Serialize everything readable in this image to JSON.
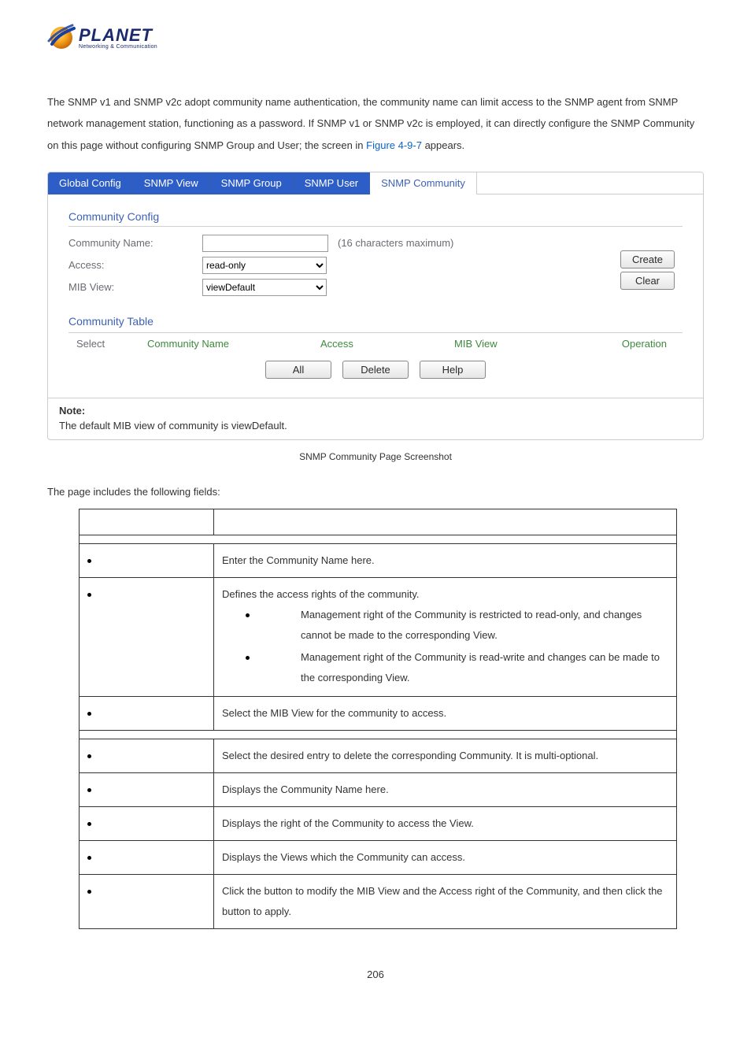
{
  "logo": {
    "word": "PLANET",
    "subtitle": "Networking & Communication"
  },
  "intro": {
    "text_before_link": "The SNMP v1 and SNMP v2c adopt community name authentication, the community name can limit access to the SNMP agent from SNMP network management station, functioning as a password. If SNMP v1 or SNMP v2c is employed, it can directly configure the SNMP Community on this page without configuring SNMP Group and User; the screen in ",
    "link_text": "Figure 4-9-7",
    "text_after_link": " appears."
  },
  "screenshot": {
    "tabs": [
      "Global Config",
      "SNMP View",
      "SNMP Group",
      "SNMP User",
      "SNMP Community"
    ],
    "active_tab_index": 4,
    "community_config": {
      "title": "Community Config",
      "rows": {
        "name_label": "Community Name:",
        "name_value": "",
        "name_hint": "(16 characters maximum)",
        "access_label": "Access:",
        "access_value": "read-only",
        "mib_label": "MIB View:",
        "mib_value": "viewDefault"
      },
      "buttons": {
        "create": "Create",
        "clear": "Clear"
      }
    },
    "community_table": {
      "title": "Community Table",
      "headers": {
        "select": "Select",
        "cname": "Community Name",
        "access": "Access",
        "mib": "MIB View",
        "op": "Operation"
      },
      "buttons": {
        "all": "All",
        "delete": "Delete",
        "help": "Help"
      }
    },
    "note": {
      "title": "Note:",
      "text": "The default MIB view of community is viewDefault."
    }
  },
  "caption": "SNMP Community Page Screenshot",
  "intro2": "The page includes the following fields:",
  "fields": {
    "rows": [
      {
        "desc": "Enter the Community Name here."
      },
      {
        "desc_lead": "Defines the access rights of the community.",
        "sub": [
          "Management right of the Community is restricted to read-only, and changes cannot be made to the corresponding View.",
          "Management right of the Community is read-write and changes can be made to the corresponding View."
        ]
      },
      {
        "desc": "Select the MIB View for the community to access."
      },
      {
        "desc": "Select the desired entry to delete the corresponding Community. It is multi-optional."
      },
      {
        "desc": "Displays the Community Name here."
      },
      {
        "desc": "Displays the right of the Community to access the View."
      },
      {
        "desc": "Displays the Views which the Community can access."
      },
      {
        "desc_parts": [
          "Click the ",
          " button to modify the MIB View and the Access right of the Community, and then click the ",
          " button to apply."
        ]
      }
    ]
  },
  "page_number": "206"
}
